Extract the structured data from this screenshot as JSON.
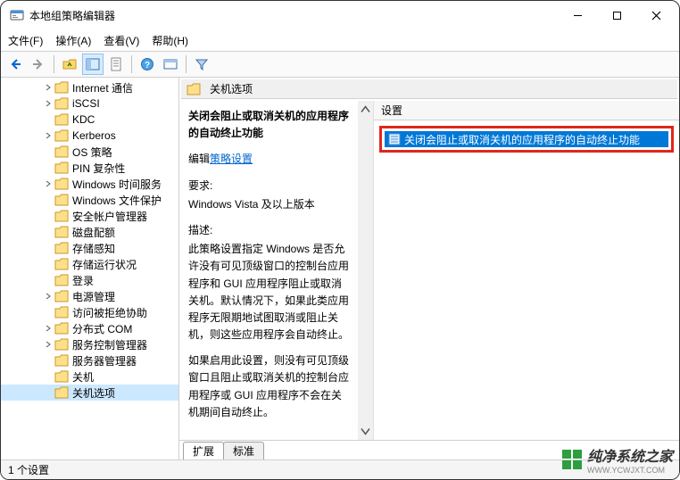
{
  "window": {
    "title": "本地组策略编辑器"
  },
  "menus": {
    "file": "文件(F)",
    "action": "操作(A)",
    "view": "查看(V)",
    "help": "帮助(H)"
  },
  "tree": {
    "items": [
      {
        "label": "Internet 通信",
        "indent": 4,
        "toggle": ">"
      },
      {
        "label": "iSCSI",
        "indent": 4,
        "toggle": ">"
      },
      {
        "label": "KDC",
        "indent": 4,
        "toggle": ""
      },
      {
        "label": "Kerberos",
        "indent": 4,
        "toggle": ">"
      },
      {
        "label": "OS 策略",
        "indent": 4,
        "toggle": ""
      },
      {
        "label": "PIN 复杂性",
        "indent": 4,
        "toggle": ""
      },
      {
        "label": "Windows 时间服务",
        "indent": 4,
        "toggle": ">"
      },
      {
        "label": "Windows 文件保护",
        "indent": 4,
        "toggle": ""
      },
      {
        "label": "安全帐户管理器",
        "indent": 4,
        "toggle": ""
      },
      {
        "label": "磁盘配额",
        "indent": 4,
        "toggle": ""
      },
      {
        "label": "存储感知",
        "indent": 4,
        "toggle": ""
      },
      {
        "label": "存储运行状况",
        "indent": 4,
        "toggle": ""
      },
      {
        "label": "登录",
        "indent": 4,
        "toggle": ""
      },
      {
        "label": "电源管理",
        "indent": 4,
        "toggle": ">"
      },
      {
        "label": "访问被拒绝协助",
        "indent": 4,
        "toggle": ""
      },
      {
        "label": "分布式 COM",
        "indent": 4,
        "toggle": ">"
      },
      {
        "label": "服务控制管理器",
        "indent": 4,
        "toggle": ">"
      },
      {
        "label": "服务器管理器",
        "indent": 4,
        "toggle": ""
      },
      {
        "label": "关机",
        "indent": 4,
        "toggle": ""
      },
      {
        "label": "关机选项",
        "indent": 4,
        "toggle": "",
        "selected": true
      }
    ]
  },
  "path_header": "关机选项",
  "description": {
    "policy_title": "关闭会阻止或取消关机的应用程序的自动终止功能",
    "edit_prefix": "编辑",
    "edit_link": "策略设置",
    "req_label": "要求:",
    "req_value": "Windows Vista 及以上版本",
    "desc_label": "描述:",
    "desc_p1": "此策略设置指定 Windows 是否允许没有可见顶级窗口的控制台应用程序和 GUI 应用程序阻止或取消关机。默认情况下，如果此类应用程序无限期地试图取消或阻止关机，则这些应用程序会自动终止。",
    "desc_p2": "如果启用此设置，则没有可见顶级窗口且阻止或取消关机的控制台应用程序或 GUI 应用程序不会在关机期间自动终止。"
  },
  "settings": {
    "header": "设置",
    "item": "关闭会阻止或取消关机的应用程序的自动终止功能"
  },
  "tabs": {
    "extended": "扩展",
    "standard": "标准"
  },
  "statusbar": "1 个设置",
  "watermark": {
    "main": "纯净系统之家",
    "sub": "WWW.YCWJXT.COM"
  }
}
